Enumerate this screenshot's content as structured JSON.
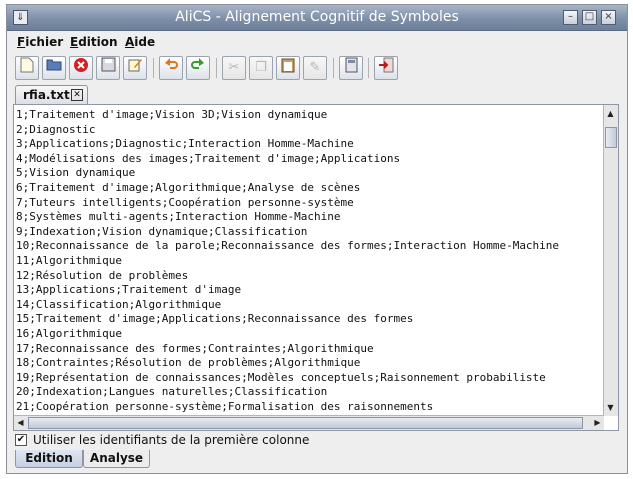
{
  "window": {
    "title": "AliCS - Alignement Cognitif de Symboles"
  },
  "menu": [
    {
      "label": "Fichier",
      "mnemonic": "F",
      "rest": "ichier"
    },
    {
      "label": "Edition",
      "mnemonic": "E",
      "rest": "dition"
    },
    {
      "label": "Aide",
      "mnemonic": "A",
      "rest": "ide"
    }
  ],
  "toolbar_icons": [
    "new-file-icon",
    "open-folder-icon",
    "close-red-icon",
    "save-icon",
    "edit-icon",
    "undo-icon",
    "redo-icon",
    "cut-icon",
    "copy-icon",
    "paste-icon",
    "brush-icon",
    "calculator-icon",
    "exit-icon"
  ],
  "document_tab": {
    "label": "rfia.txt"
  },
  "lines": [
    "1;Traitement d'image;Vision 3D;Vision dynamique",
    "2;Diagnostic",
    "3;Applications;Diagnostic;Interaction Homme-Machine",
    "4;Modélisations des images;Traitement d'image;Applications",
    "5;Vision dynamique",
    "6;Traitement d'image;Algorithmique;Analyse de scènes",
    "7;Tuteurs intelligents;Coopération personne-système",
    "8;Systèmes multi-agents;Interaction Homme-Machine",
    "9;Indexation;Vision dynamique;Classification",
    "10;Reconnaissance de la parole;Reconnaissance des formes;Interaction Homme-Machine",
    "11;Algorithmique",
    "12;Résolution de problèmes",
    "13;Applications;Traitement d'image",
    "14;Classification;Algorithmique",
    "15;Traitement d'image;Applications;Reconnaissance des formes",
    "16;Algorithmique",
    "17;Reconnaissance des formes;Contraintes;Algorithmique",
    "18;Contraintes;Résolution de problèmes;Algorithmique",
    "19;Représentation de connaissances;Modèles conceptuels;Raisonnement probabiliste",
    "20;Indexation;Langues naturelles;Classification",
    "21;Coopération personne-système;Formalisation des raisonnements"
  ],
  "checkbox": {
    "label": "Utiliser les identifiants de la première colonne",
    "checked": true
  },
  "bottom_tabs": [
    {
      "label": "Edition",
      "active": true
    },
    {
      "label": "Analyse",
      "active": false
    }
  ]
}
